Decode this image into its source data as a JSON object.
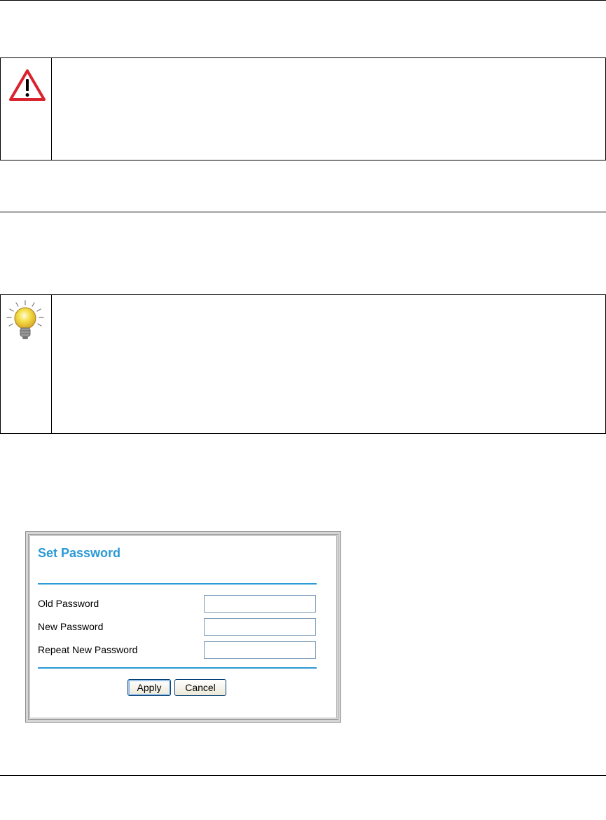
{
  "dialog": {
    "title": "Set Password",
    "fields": [
      {
        "label": "Old Password",
        "value": ""
      },
      {
        "label": "New Password",
        "value": ""
      },
      {
        "label": "Repeat New Password",
        "value": ""
      }
    ],
    "apply_label": "Apply",
    "cancel_label": "Cancel"
  },
  "colors": {
    "accent": "#2b9ad6",
    "warning_red": "#d9232e",
    "bulb_yellow": "#f5e04a"
  },
  "icons": {
    "warning": "warning-triangle-icon",
    "tip": "lightbulb-icon"
  }
}
